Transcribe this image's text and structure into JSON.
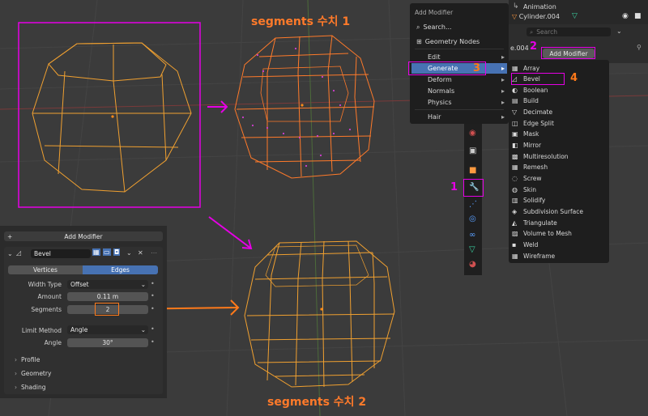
{
  "annotations": {
    "top_title": "segments 수치 1",
    "bottom_title": "segments 수치 2",
    "step1": "1",
    "step2": "2",
    "step3": "3",
    "step4": "4"
  },
  "outliner": {
    "row1": "Animation",
    "row2": "Cylinder.004",
    "search_placeholder": "Search",
    "object_name": "e.004",
    "add_modifier": "Add Modifier"
  },
  "add_modifier_menu": {
    "title": "Add Modifier",
    "search": "Search...",
    "geometry_nodes": "Geometry Nodes",
    "items": [
      "Edit",
      "Generate",
      "Deform",
      "Normals",
      "Physics",
      "Hair"
    ]
  },
  "generate_submenu": {
    "items": [
      "Array",
      "Bevel",
      "Boolean",
      "Build",
      "Decimate",
      "Edge Split",
      "Mask",
      "Mirror",
      "Multiresolution",
      "Remesh",
      "Screw",
      "Skin",
      "Solidify",
      "Subdivision Surface",
      "Triangulate",
      "Volume to Mesh",
      "Weld",
      "Wireframe"
    ]
  },
  "modifier_panel": {
    "add_modifier": "Add Modifier",
    "modifier_name": "Bevel",
    "tab_vertices": "Vertices",
    "tab_edges": "Edges",
    "width_type_label": "Width Type",
    "width_type_value": "Offset",
    "amount_label": "Amount",
    "amount_value": "0.11 m",
    "segments_label": "Segments",
    "segments_value": "2",
    "limit_method_label": "Limit Method",
    "limit_method_value": "Angle",
    "angle_label": "Angle",
    "angle_value": "30°",
    "sections": [
      "Profile",
      "Geometry",
      "Shading"
    ]
  },
  "colors": {
    "accent_magenta": "#e600e6",
    "accent_orange": "#ff7a1a",
    "selected_blue": "#4772b3",
    "wire_orange": "#f0a030"
  }
}
